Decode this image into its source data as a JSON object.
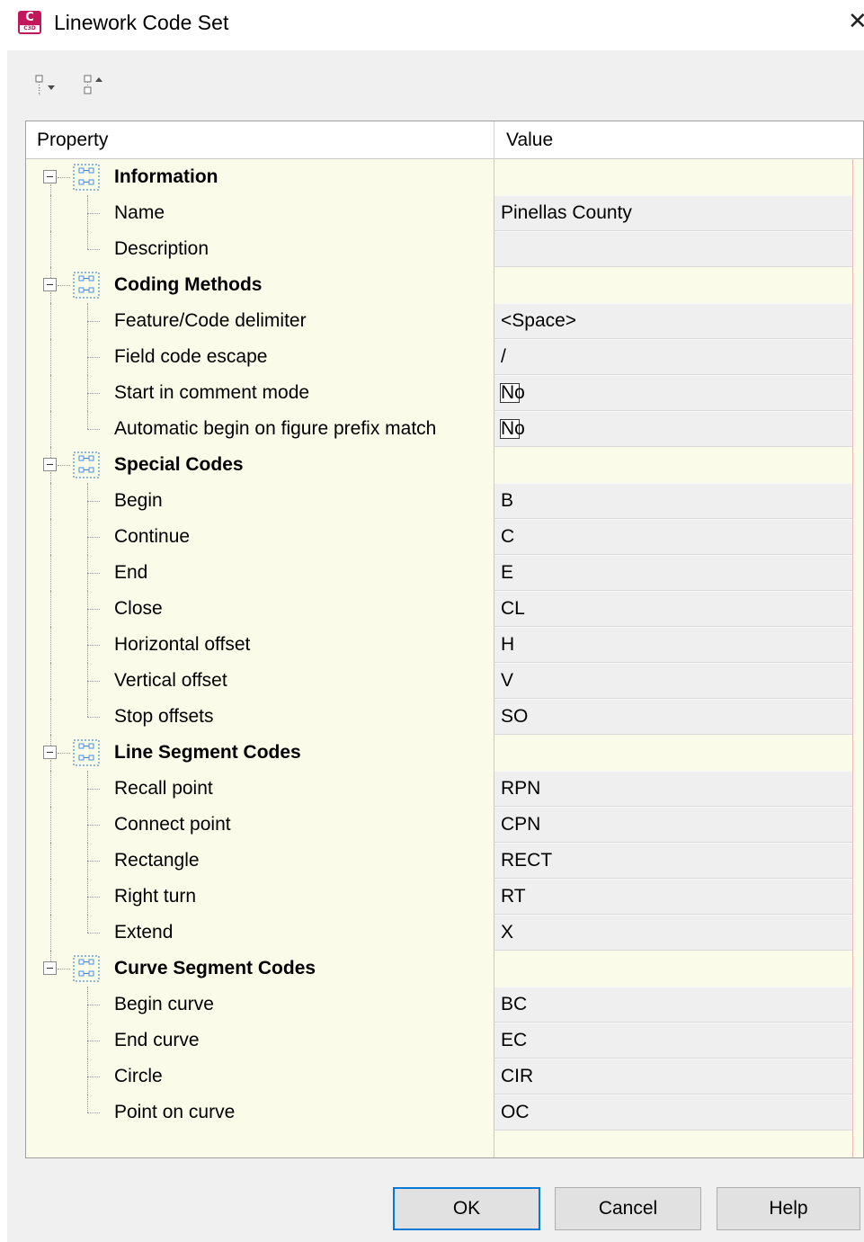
{
  "window": {
    "title": "Linework Code Set",
    "app_icon_letter": "C",
    "app_icon_sub": "C3D",
    "close_glyph": "✕"
  },
  "toolbar": {
    "buttons": [
      {
        "name": "expand-all",
        "icon": "tree-expand-icon"
      },
      {
        "name": "collapse-all",
        "icon": "tree-collapse-icon"
      }
    ]
  },
  "grid": {
    "headers": {
      "property": "Property",
      "value": "Value"
    },
    "categories": [
      {
        "label": "Information",
        "items": [
          {
            "label": "Name",
            "value": "Pinellas County"
          },
          {
            "label": "Description",
            "value": ""
          }
        ]
      },
      {
        "label": "Coding Methods",
        "items": [
          {
            "label": "Feature/Code delimiter",
            "value": "<Space>"
          },
          {
            "label": "Field code escape",
            "value": "/"
          },
          {
            "label": "Start in comment mode",
            "value": "No",
            "checkbox": true
          },
          {
            "label": "Automatic begin on figure prefix match",
            "value": "No",
            "checkbox": true
          }
        ]
      },
      {
        "label": "Special Codes",
        "items": [
          {
            "label": "Begin",
            "value": "B"
          },
          {
            "label": "Continue",
            "value": "C"
          },
          {
            "label": "End",
            "value": "E"
          },
          {
            "label": "Close",
            "value": "CL"
          },
          {
            "label": "Horizontal offset",
            "value": "H"
          },
          {
            "label": "Vertical offset",
            "value": "V"
          },
          {
            "label": "Stop offsets",
            "value": "SO"
          }
        ]
      },
      {
        "label": "Line Segment Codes",
        "items": [
          {
            "label": "Recall point",
            "value": "RPN"
          },
          {
            "label": "Connect point",
            "value": "CPN"
          },
          {
            "label": "Rectangle",
            "value": "RECT"
          },
          {
            "label": "Right turn",
            "value": "RT"
          },
          {
            "label": "Extend",
            "value": "X"
          }
        ]
      },
      {
        "label": "Curve Segment Codes",
        "items": [
          {
            "label": "Begin curve",
            "value": "BC"
          },
          {
            "label": "End curve",
            "value": "EC"
          },
          {
            "label": "Circle",
            "value": "CIR"
          },
          {
            "label": "Point on curve",
            "value": "OC"
          }
        ]
      }
    ]
  },
  "buttons": {
    "ok": "OK",
    "cancel": "Cancel",
    "help": "Help"
  },
  "colors": {
    "grid_background": "#fbfbe9",
    "value_cell": "#efefef",
    "default_button_border": "#0078d7",
    "app_icon": "#c2185b"
  }
}
